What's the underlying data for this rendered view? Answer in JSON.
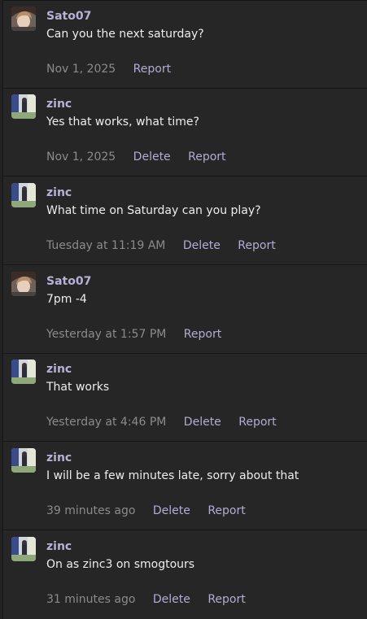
{
  "actions": {
    "delete_label": "Delete",
    "report_label": "Report"
  },
  "messages": [
    {
      "user": "Sato07",
      "avatar": "sato",
      "text": "Can you the next saturday?",
      "time": "Nov 1, 2025",
      "can_delete": false
    },
    {
      "user": "zinc",
      "avatar": "zinc",
      "text": "Yes that works, what time?",
      "time": "Nov 1, 2025",
      "can_delete": true
    },
    {
      "user": "zinc",
      "avatar": "zinc",
      "text": "What time on Saturday can you play?",
      "time": "Tuesday at 11:19 AM",
      "can_delete": true
    },
    {
      "user": "Sato07",
      "avatar": "sato",
      "text": "7pm -4",
      "time": "Yesterday at 1:57 PM",
      "can_delete": false
    },
    {
      "user": "zinc",
      "avatar": "zinc",
      "text": "That works",
      "time": "Yesterday at 4:46 PM",
      "can_delete": true
    },
    {
      "user": "zinc",
      "avatar": "zinc",
      "text": "I will be a few minutes late, sorry about that",
      "time": "39 minutes ago",
      "can_delete": true
    },
    {
      "user": "zinc",
      "avatar": "zinc",
      "text": "On as zinc3 on smogtours",
      "time": "31 minutes ago",
      "can_delete": true
    }
  ]
}
